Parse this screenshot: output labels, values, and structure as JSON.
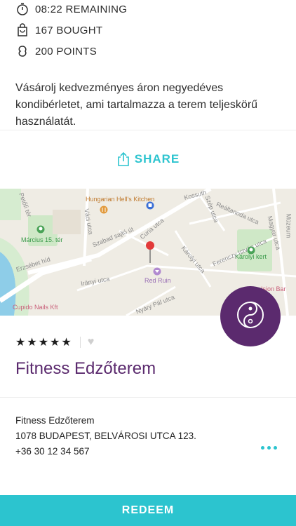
{
  "stats": {
    "remaining": "08:22 REMAINING",
    "bought": "167 BOUGHT",
    "points": "200 POINTS"
  },
  "description": "Vásárolj kedvezményes áron negyedéves kondibérletet, ami tartalmazza a terem teljeskörű használatát.",
  "share": {
    "label": "SHARE"
  },
  "map": {
    "labels": {
      "restaurant": "Hungarian Hell's Kitchen",
      "park1": "Március 15. tér",
      "park2": "Károlyi kert",
      "street1": "Szabad sajtó út",
      "street2": "Kossuth",
      "street3": "Erzsébet híd",
      "street4": "Irányi utca",
      "street5": "Nyáry Pál utca",
      "street6": "Károlyi utca",
      "street7": "Ferenczy István utca",
      "street8": "Reáltanoda utca",
      "street9": "Curia utca",
      "street10": "Váci utca",
      "street11": "Magyar utca",
      "street12": "Szép utca",
      "street13": "Petőfi tér",
      "street14": "Múzeum",
      "poi1": "Red Ruin",
      "poi2": "Cupido Nails Kft",
      "poi3": "Ision Bar"
    }
  },
  "venue": {
    "rating": 5,
    "name": "Fitness Edzőterem",
    "address_name": "Fitness Edzőterem",
    "address": "1078 BUDAPEST, BELVÁROSI UTCA 123.",
    "phone": "+36 30 12 34 567"
  },
  "redeem": {
    "label": "REDEEM"
  },
  "colors": {
    "accent": "#2cc4cf",
    "brand": "#5b2a6e"
  }
}
